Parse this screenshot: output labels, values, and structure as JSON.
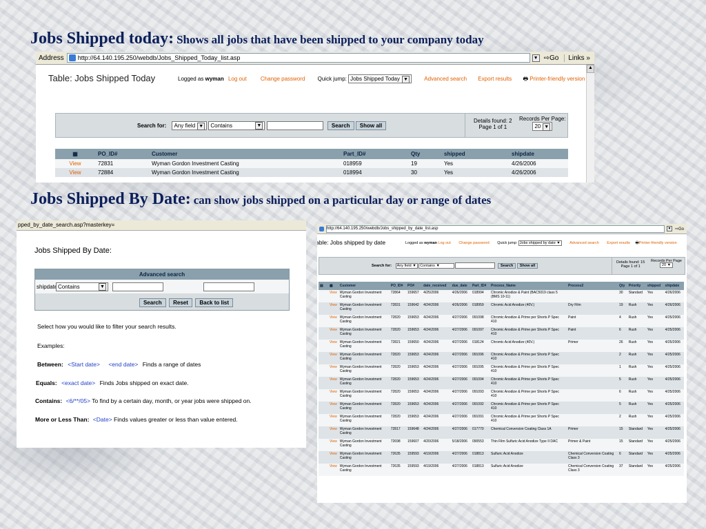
{
  "heading1": {
    "title": "Jobs Shipped today:",
    "desc": "Shows all jobs that have been shipped to your company today"
  },
  "heading2": {
    "title": "Jobs Shipped By Date:",
    "desc": "can show jobs shipped on a particular day or range of dates"
  },
  "shot1": {
    "address_label": "Address",
    "url": "http://64.140.195.250/webdb/Jobs_Shipped_Today_list.asp",
    "go": "Go",
    "links": "Links »",
    "table_title": "Table: Jobs Shipped Today",
    "logged_as": "Logged as",
    "user": "wyman",
    "logout": "Log out",
    "change_password": "Change password",
    "quick_jump_label": "Quick jump:",
    "quick_jump_value": "Jobs Shipped Today",
    "advanced_search": "Advanced search",
    "export": "Export results",
    "printer": "Printer-friendly version",
    "search_for": "Search for:",
    "field_value": "Any field",
    "op_value": "Contains",
    "search_btn": "Search",
    "showall_btn": "Show all",
    "details": "Details found: 2",
    "page": "Page 1 of 1",
    "records_label": "Records Per Page:",
    "records_value": "20",
    "columns": [
      "PO_ID#",
      "Customer",
      "Part_ID#",
      "Qty",
      "shipped",
      "shipdate"
    ],
    "rows": [
      {
        "view": "View",
        "po": "72831",
        "customer": "Wyman Gordon Investment Casting",
        "part": "018959",
        "qty": "19",
        "shipped": "Yes",
        "date": "4/26/2006"
      },
      {
        "view": "View",
        "po": "72884",
        "customer": "Wyman Gordon Investment Casting",
        "part": "018994",
        "qty": "30",
        "shipped": "Yes",
        "date": "4/26/2006"
      }
    ]
  },
  "shot2": {
    "url": "pped_by_date_search.asp?masterkey=",
    "title": "Jobs Shipped By Date:",
    "adv_header": "Advanced search",
    "field": "shipdate",
    "op": "Contains",
    "search_btn": "Search",
    "reset_btn": "Reset",
    "back_btn": "Back to list",
    "intro": "Select how you would like to filter your search results.",
    "examples": "Examples:",
    "between_label": "Between:",
    "between_code1": "<Start date>",
    "between_code2": "<end date>",
    "between_text": "Finds a range of dates",
    "equals_label": "Equals:",
    "equals_code": "<exact date>",
    "equals_text": "Finds Jobs shipped on exact date.",
    "contains_label": "Contains:",
    "contains_code": "<6/**/05>",
    "contains_text": "To find by a certain day, month, or year jobs were shipped on.",
    "morel_label": "More or Less Than:",
    "morel_code": "<Date>",
    "morel_text": "Finds values greater or less than value entered."
  },
  "shot3": {
    "url": "http://64.140.195.250/webdb/Jobs_shipped_by_date_list.asp",
    "go": "Go",
    "table_title": "able: Jobs shipped by date",
    "logged_as": "Logged as",
    "user": "wyman",
    "logout": "Log out",
    "change_password": "Change password",
    "quick_jump_label": "Quick jump:",
    "quick_jump_value": "Jobs shipped by date",
    "advanced_search": "Advanced search",
    "export": "Export results",
    "printer": "Printer-friendly version",
    "search_for": "Search for:",
    "field_value": "Any field",
    "op_value": "Contains",
    "search_btn": "Search",
    "showall_btn": "Show all",
    "details": "Details found: 15",
    "page": "Page 1 of 1",
    "records_label": "Records Per Page",
    "records_value": "20",
    "columns": [
      "Customer",
      "PO_ID#",
      "PO#",
      "date_received",
      "due_date",
      "Part_ID#",
      "Process_Name",
      "Process2",
      "Qty",
      "Priority",
      "shipped",
      "shipdate"
    ],
    "rows": [
      {
        "view": "View",
        "customer": "Wyman Gordon Investment Casting",
        "po_id": "72864",
        "po": "159657",
        "recv": "4/25/2006",
        "due": "4/26/2006",
        "part": "018994",
        "process": "Chromic Anodize & Paint (BAC5019 class 5 (BMS 10-11)",
        "process2": "",
        "qty": "30",
        "priority": "Standard",
        "shipped": "Yes",
        "shipdate": "4/26/2006"
      },
      {
        "view": "View",
        "customer": "Wyman Gordon Investment Casting",
        "po_id": "72831",
        "po": "159642",
        "recv": "4/24/2006",
        "due": "4/26/2006",
        "part": "018959",
        "process": "Chromic Acid Anodize (40V.)",
        "process2": "Dry Film",
        "qty": "19",
        "priority": "Rush",
        "shipped": "Yes",
        "shipdate": "4/26/2006"
      },
      {
        "view": "View",
        "customer": "Wyman Gordon Investment Casting",
        "po_id": "72820",
        "po": "159653",
        "recv": "4/24/2006",
        "due": "4/27/2006",
        "part": "091098",
        "process": "Chromic Anodize & Prime per Shorts P Spec 410",
        "process2": "Paint",
        "qty": "4",
        "priority": "Rush",
        "shipped": "Yes",
        "shipdate": "4/25/2006"
      },
      {
        "view": "View",
        "customer": "Wyman Gordon Investment Casting",
        "po_id": "72820",
        "po": "159653",
        "recv": "4/24/2006",
        "due": "4/27/2006",
        "part": "091097",
        "process": "Chromic Anodize & Prime per Shorts P Spec 410",
        "process2": "Paint",
        "qty": "6",
        "priority": "Rush",
        "shipped": "Yes",
        "shipdate": "4/25/2006"
      },
      {
        "view": "View",
        "customer": "Wyman Gordon Investment Casting",
        "po_id": "72821",
        "po": "159650",
        "recv": "4/24/2006",
        "due": "4/27/2006",
        "part": "018124",
        "process": "Chromic Acid Anodize (40V.)",
        "process2": "Primer",
        "qty": "26",
        "priority": "Rush",
        "shipped": "Yes",
        "shipdate": "4/25/2006"
      },
      {
        "view": "View",
        "customer": "Wyman Gordon Investment Casting",
        "po_id": "72820",
        "po": "159653",
        "recv": "4/24/2006",
        "due": "4/27/2006",
        "part": "091096",
        "process": "Chromic Anodize & Prime per Shorts P Spec 410",
        "process2": "",
        "qty": "2",
        "priority": "Rush",
        "shipped": "Yes",
        "shipdate": "4/25/2006"
      },
      {
        "view": "View",
        "customer": "Wyman Gordon Investment Casting",
        "po_id": "72820",
        "po": "159653",
        "recv": "4/24/2006",
        "due": "4/27/2006",
        "part": "091095",
        "process": "Chromic Anodize & Prime per Shorts P Spec 410",
        "process2": "",
        "qty": "1",
        "priority": "Rush",
        "shipped": "Yes",
        "shipdate": "4/25/2006"
      },
      {
        "view": "View",
        "customer": "Wyman Gordon Investment Casting",
        "po_id": "72820",
        "po": "159653",
        "recv": "4/24/2006",
        "due": "4/27/2006",
        "part": "091094",
        "process": "Chromic Anodize & Prime per Shorts P Spec 410",
        "process2": "",
        "qty": "5",
        "priority": "Rush",
        "shipped": "Yes",
        "shipdate": "4/25/2006"
      },
      {
        "view": "View",
        "customer": "Wyman Gordon Investment Casting",
        "po_id": "72820",
        "po": "159653",
        "recv": "4/24/2006",
        "due": "4/27/2006",
        "part": "091093",
        "process": "Chromic Anodize & Prime per Shorts P Spec 410",
        "process2": "",
        "qty": "6",
        "priority": "Rush",
        "shipped": "Yes",
        "shipdate": "4/25/2006"
      },
      {
        "view": "View",
        "customer": "Wyman Gordon Investment Casting",
        "po_id": "72820",
        "po": "159653",
        "recv": "4/24/2006",
        "due": "4/27/2006",
        "part": "091092",
        "process": "Chromic Anodize & Prime per Shorts P Spec 410",
        "process2": "",
        "qty": "5",
        "priority": "Rush",
        "shipped": "Yes",
        "shipdate": "4/25/2006"
      },
      {
        "view": "View",
        "customer": "Wyman Gordon Investment Casting",
        "po_id": "72820",
        "po": "159653",
        "recv": "4/24/2006",
        "due": "4/27/2006",
        "part": "091091",
        "process": "Chromic Anodize & Prime per Shorts P Spec 410",
        "process2": "",
        "qty": "2",
        "priority": "Rush",
        "shipped": "Yes",
        "shipdate": "4/25/2006"
      },
      {
        "view": "View",
        "customer": "Wyman Gordon Investment Casting",
        "po_id": "72817",
        "po": "159648",
        "recv": "4/24/2006",
        "due": "4/27/2006",
        "part": "017770",
        "process": "Chemical Conversion Coating Class 1A",
        "process2": "Primer",
        "qty": "15",
        "priority": "Standard",
        "shipped": "Yes",
        "shipdate": "4/25/2006"
      },
      {
        "view": "View",
        "customer": "Wyman Gordon Investment Casting",
        "po_id": "72698",
        "po": "159607",
        "recv": "4/20/2006",
        "due": "5/18/2006",
        "part": "090553",
        "process": "Thin Film Sulfuric Acid Anodize Type II DAC",
        "process2": "Primer & Paint",
        "qty": "15",
        "priority": "Standard",
        "shipped": "Yes",
        "shipdate": "4/25/2006"
      },
      {
        "view": "View",
        "customer": "Wyman Gordon Investment Casting",
        "po_id": "72635",
        "po": "159593",
        "recv": "4/19/2006",
        "due": "4/27/2006",
        "part": "018813",
        "process": "Sulfuric Acid Anodize",
        "process2": "Chemical Conversion Coating Class 3",
        "qty": "6",
        "priority": "Standard",
        "shipped": "Yes",
        "shipdate": "4/25/2006"
      },
      {
        "view": "View",
        "customer": "Wyman Gordon Investment Casting",
        "po_id": "72635",
        "po": "159593",
        "recv": "4/19/2006",
        "due": "4/27/2006",
        "part": "018813",
        "process": "Sulfuric Acid Anodize",
        "process2": "Chemical Conversion Coating Class 3",
        "qty": "37",
        "priority": "Standard",
        "shipped": "Yes",
        "shipdate": "4/25/2006"
      }
    ]
  }
}
